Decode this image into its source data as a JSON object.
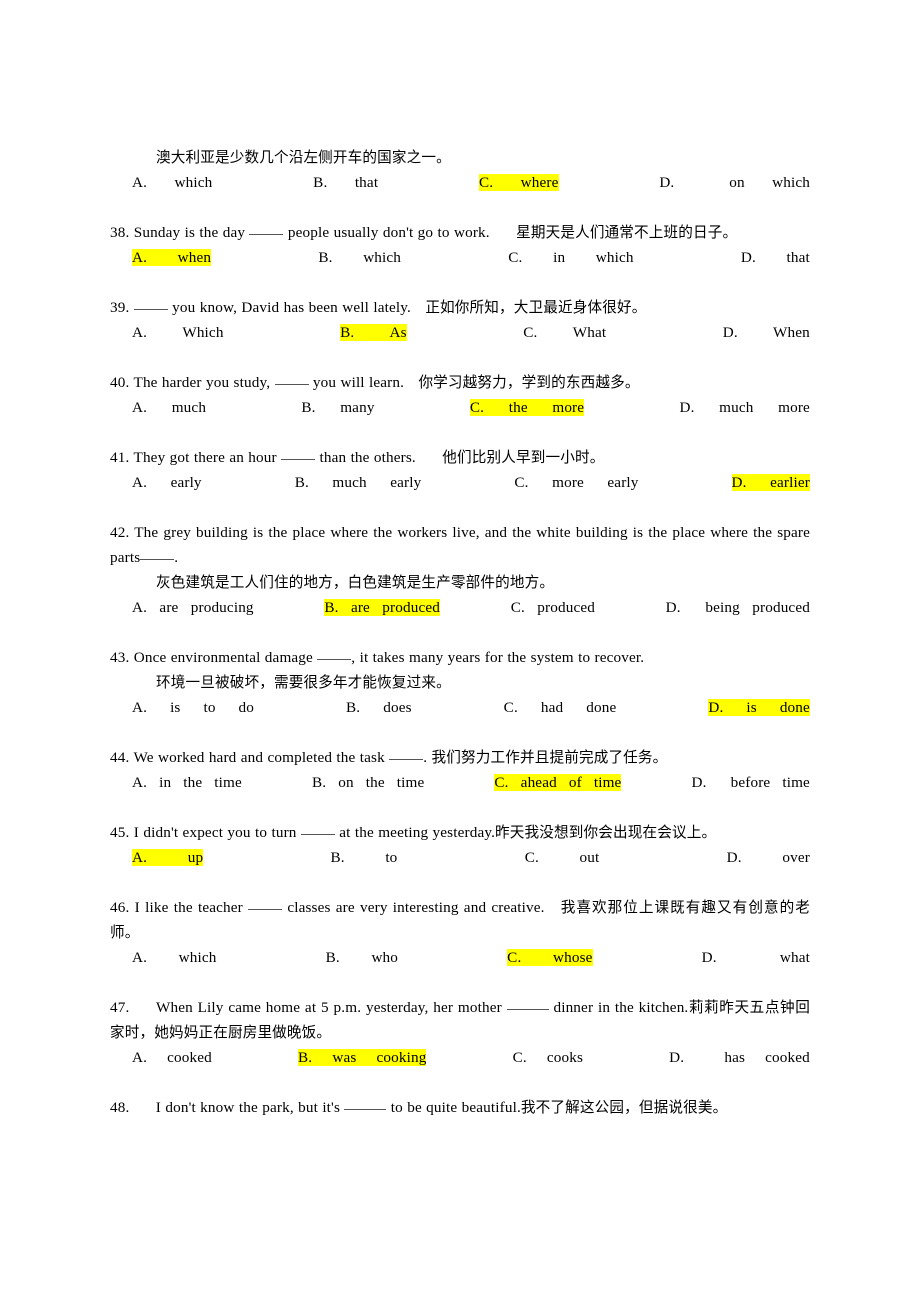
{
  "document": {
    "type": "english-grammar-worksheet",
    "language_mix": "english-chinese",
    "highlight_color": "#ffff00",
    "page_background": "#ffffff",
    "text_color": "#000000"
  },
  "blocks": [
    {
      "id": "q37-translation",
      "kind": "chinese-translation",
      "text": "澳大利亚是少数几个沿左侧开车的国家之一。"
    },
    {
      "id": "q37-options",
      "kind": "options",
      "options": [
        {
          "letter": "A.",
          "text": "which",
          "highlighted": false
        },
        {
          "letter": "B.",
          "text": "that",
          "highlighted": false
        },
        {
          "letter": "C.",
          "text": "where",
          "highlighted": true
        },
        {
          "letter": "D.",
          "text": "on which",
          "highlighted": false
        }
      ]
    },
    {
      "id": "q38-stem",
      "kind": "question",
      "number": "38.",
      "english_before": "Sunday is the day",
      "english_after": "people usually don't go to work.",
      "chinese": "星期天是人们通常不上班的日子。"
    },
    {
      "id": "q38-options",
      "kind": "options",
      "options": [
        {
          "letter": "A.",
          "text": "when",
          "highlighted": true
        },
        {
          "letter": "B.",
          "text": "which",
          "highlighted": false
        },
        {
          "letter": "C.",
          "text": "in which",
          "highlighted": false
        },
        {
          "letter": "D.",
          "text": "that",
          "highlighted": false
        }
      ]
    },
    {
      "id": "q39-stem",
      "kind": "question",
      "number": "39.",
      "english_before": "",
      "english_after": "you know, David has been well lately.",
      "chinese": "正如你所知，大卫最近身体很好。"
    },
    {
      "id": "q39-options",
      "kind": "options",
      "options": [
        {
          "letter": "A.",
          "text": "Which",
          "highlighted": false
        },
        {
          "letter": "B.",
          "text": "As",
          "highlighted": true
        },
        {
          "letter": "C.",
          "text": "What",
          "highlighted": false
        },
        {
          "letter": "D.",
          "text": "When",
          "highlighted": false
        }
      ]
    },
    {
      "id": "q40-stem",
      "kind": "question",
      "number": "40.",
      "english_before": "The harder you study,",
      "english_after": "you will learn.",
      "chinese": "你学习越努力，学到的东西越多。"
    },
    {
      "id": "q40-options",
      "kind": "options",
      "options": [
        {
          "letter": "A.",
          "text": "much",
          "highlighted": false
        },
        {
          "letter": "B.",
          "text": "many",
          "highlighted": false
        },
        {
          "letter": "C.",
          "text": "the more",
          "highlighted": true
        },
        {
          "letter": "D.",
          "text": "much more",
          "highlighted": false
        }
      ]
    },
    {
      "id": "q41-stem",
      "kind": "question",
      "number": "41.",
      "english_before": "They got there an hour",
      "english_after": "than the others.",
      "chinese": "他们比别人早到一小时。"
    },
    {
      "id": "q41-options",
      "kind": "options",
      "options": [
        {
          "letter": "A.",
          "text": "early",
          "highlighted": false
        },
        {
          "letter": "B.",
          "text": "much early",
          "highlighted": false
        },
        {
          "letter": "C.",
          "text": "more early",
          "highlighted": false
        },
        {
          "letter": "D.",
          "text": "earlier",
          "highlighted": true
        }
      ]
    },
    {
      "id": "q42-stem",
      "kind": "question",
      "number": "42.",
      "english_line1": "The grey building is the place where the workers live, and the white building is the",
      "english_line2": "place where the spare parts",
      "chinese": "灰色建筑是工人们住的地方，白色建筑是生产零部件的地方。"
    },
    {
      "id": "q42-options",
      "kind": "options",
      "options": [
        {
          "letter": "A.",
          "text": "are producing",
          "highlighted": false
        },
        {
          "letter": "B.",
          "text": "are produced",
          "highlighted": true
        },
        {
          "letter": "C.",
          "text": "produced",
          "highlighted": false
        },
        {
          "letter": "D.",
          "text": "being produced",
          "highlighted": false
        }
      ]
    },
    {
      "id": "q43-stem",
      "kind": "question",
      "number": "43.",
      "english_before": "Once environmental damage",
      "english_after": ", it takes many years for the system to recover.",
      "chinese": "环境一旦被破坏，需要很多年才能恢复过来。"
    },
    {
      "id": "q43-options",
      "kind": "options",
      "options": [
        {
          "letter": "A.",
          "text": "is to do",
          "highlighted": false
        },
        {
          "letter": "B.",
          "text": "does",
          "highlighted": false
        },
        {
          "letter": "C.",
          "text": "had done",
          "highlighted": false
        },
        {
          "letter": "D.",
          "text": "is done",
          "highlighted": true
        }
      ]
    },
    {
      "id": "q44-stem",
      "kind": "question",
      "number": "44.",
      "english_before": "We worked hard and completed the task",
      "english_after": ".",
      "chinese": "我们努力工作并且提前完成了任务。"
    },
    {
      "id": "q44-options",
      "kind": "options",
      "options": [
        {
          "letter": "A.",
          "text": "in the time",
          "highlighted": false
        },
        {
          "letter": "B.",
          "text": "on the time",
          "highlighted": false
        },
        {
          "letter": "C.",
          "text": "ahead of time",
          "highlighted": true
        },
        {
          "letter": "D.",
          "text": "before time",
          "highlighted": false
        }
      ]
    },
    {
      "id": "q45-stem",
      "kind": "question",
      "number": "45.",
      "english_before": "I didn't expect you to turn",
      "english_after": "at the meeting yesterday.",
      "chinese": "昨天我没想到你会出现在会议上。"
    },
    {
      "id": "q45-options",
      "kind": "options",
      "options": [
        {
          "letter": "A.",
          "text": "up",
          "highlighted": true
        },
        {
          "letter": "B.",
          "text": "to",
          "highlighted": false
        },
        {
          "letter": "C.",
          "text": "out",
          "highlighted": false
        },
        {
          "letter": "D.",
          "text": "over",
          "highlighted": false
        }
      ]
    },
    {
      "id": "q46-stem",
      "kind": "question",
      "number": "46.",
      "english_before": "I like the teacher",
      "english_after": "classes are very interesting and creative.",
      "chinese": "我喜欢那位上课既有趣又有创意的老师。"
    },
    {
      "id": "q46-options",
      "kind": "options",
      "options": [
        {
          "letter": "A.",
          "text": "which",
          "highlighted": false
        },
        {
          "letter": "B.",
          "text": "who",
          "highlighted": false
        },
        {
          "letter": "C.",
          "text": "whose",
          "highlighted": true
        },
        {
          "letter": "D.",
          "text": "what",
          "highlighted": false
        }
      ]
    },
    {
      "id": "q47-stem",
      "kind": "question",
      "number": "47.",
      "english_before": "When Lily came home at 5 p.m. yesterday, her mother",
      "english_after": "dinner in the kitchen.",
      "chinese": "莉莉昨天五点钟回家时，她妈妈正在厨房里做晚饭。"
    },
    {
      "id": "q47-options",
      "kind": "options",
      "options": [
        {
          "letter": "A.",
          "text": "cooked",
          "highlighted": false
        },
        {
          "letter": "B.",
          "text": "was cooking",
          "highlighted": true
        },
        {
          "letter": "C.",
          "text": "cooks",
          "highlighted": false
        },
        {
          "letter": "D.",
          "text": "has cooked",
          "highlighted": false
        }
      ]
    },
    {
      "id": "q48-stem",
      "kind": "question",
      "number": "48.",
      "english_before": "I don't know the park, but it's",
      "english_after": "to be quite beautiful.",
      "chinese": "我不了解这公园，但据说很美。"
    }
  ]
}
